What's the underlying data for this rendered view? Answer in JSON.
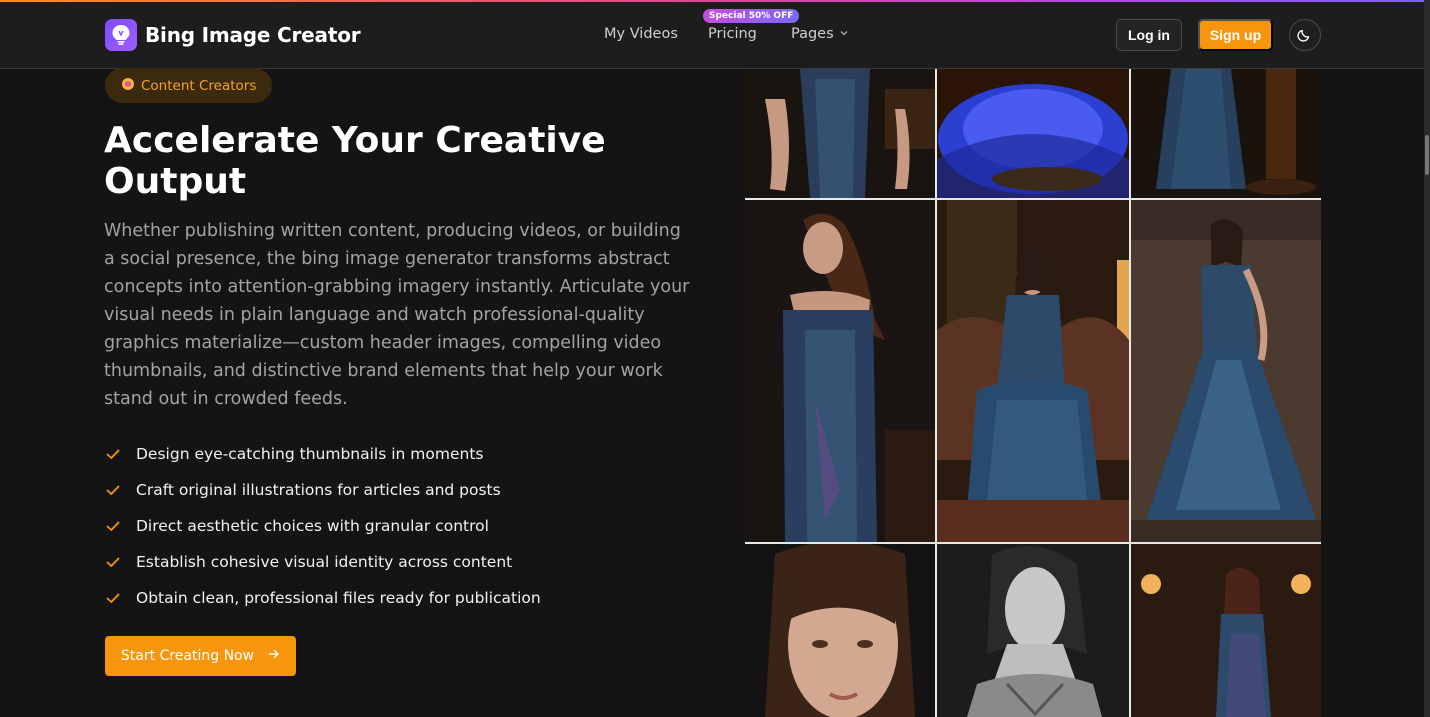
{
  "brand": {
    "name": "Bing Image Creator",
    "logo_icon": "lightbulb-icon",
    "accent": "#7a4cff"
  },
  "nav": {
    "items": [
      "My Videos",
      "Pricing",
      "Pages"
    ],
    "promo_badge": "Special 50% OFF"
  },
  "auth": {
    "login_label": "Log in",
    "signup_label": "Sign up",
    "theme_icon": "moon-icon"
  },
  "hero": {
    "pill_label": "Content Creators",
    "pill_icon": "brain-emoji",
    "title": "Accelerate Your Creative Output",
    "description": "Whether publishing written content, producing videos, or building a social presence, the bing image generator transforms abstract concepts into attention-grabbing imagery instantly. Articulate your visual needs in plain language and watch professional-quality graphics materialize—custom header images, compelling video thumbnails, and distinctive brand elements that help your work stand out in crowded feeds.",
    "features": [
      "Design eye-catching thumbnails in moments",
      "Craft original illustrations for articles and posts",
      "Direct aesthetic choices with granular control",
      "Establish cohesive visual identity across content",
      "Obtain clean, professional files ready for publication"
    ],
    "cta_label": "Start Creating Now"
  },
  "colors": {
    "orange": "#f7950f",
    "background": "#141414",
    "header": "#1d1d1d"
  }
}
